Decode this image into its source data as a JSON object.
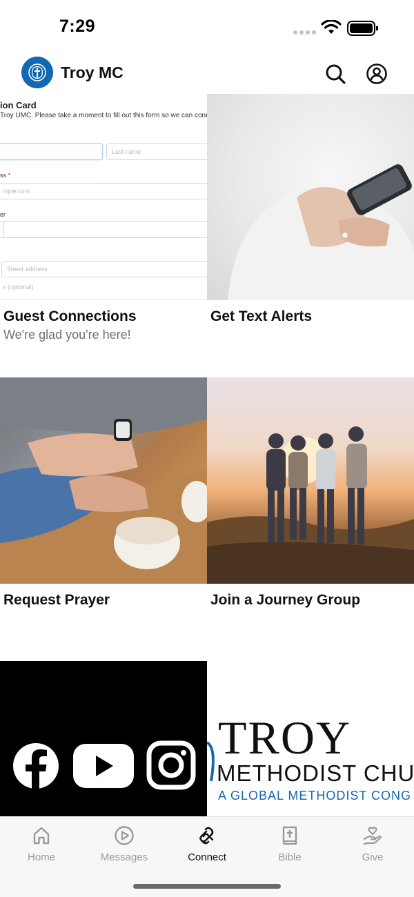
{
  "status_bar": {
    "time": "7:29"
  },
  "header": {
    "title": "Troy MC",
    "icons": {
      "logo": "church-cross-logo",
      "search": "search-icon",
      "account": "account-icon"
    }
  },
  "tiles": [
    {
      "title": "Guest Connections",
      "subtitle": "We're glad you're here!",
      "image": "form-screenshot",
      "form_preview": {
        "title": "ion Card",
        "description": "Troy UMC. Please take a moment to fill out this form so we can connect",
        "last_name_placeholder": "Last name",
        "email_label": "ss",
        "email_required_mark": "*",
        "email_placeholder": "mple.com",
        "phone_label": "er",
        "street_placeholder": "Street address",
        "optional_placeholder": "x (optional)"
      }
    },
    {
      "title": "Get Text Alerts",
      "image": "person-texting-photo"
    },
    {
      "title": "Request Prayer",
      "image": "holding-hands-coffee-photo"
    },
    {
      "title": "Join a Journey Group",
      "image": "friends-sunset-photo"
    },
    {
      "title": "",
      "image": "social-media-icons",
      "icons": [
        "facebook-icon",
        "youtube-icon",
        "instagram-icon"
      ]
    },
    {
      "title": "",
      "image": "troy-methodist-logo",
      "logo_text": {
        "word": "TROY",
        "church": "METHODIST CHU",
        "tagline": "A GLOBAL METHODIST CONG"
      }
    }
  ],
  "tab_bar": {
    "tabs": [
      {
        "label": "Home",
        "icon": "home-icon",
        "active": false
      },
      {
        "label": "Messages",
        "icon": "play-circle-icon",
        "active": false
      },
      {
        "label": "Connect",
        "icon": "connect-icon",
        "active": true
      },
      {
        "label": "Bible",
        "icon": "bible-icon",
        "active": false
      },
      {
        "label": "Give",
        "icon": "give-hand-heart-icon",
        "active": false
      }
    ]
  },
  "colors": {
    "brand": "#1268b3",
    "active_tab": "#111111",
    "inactive_tab": "#9a9a9a"
  }
}
